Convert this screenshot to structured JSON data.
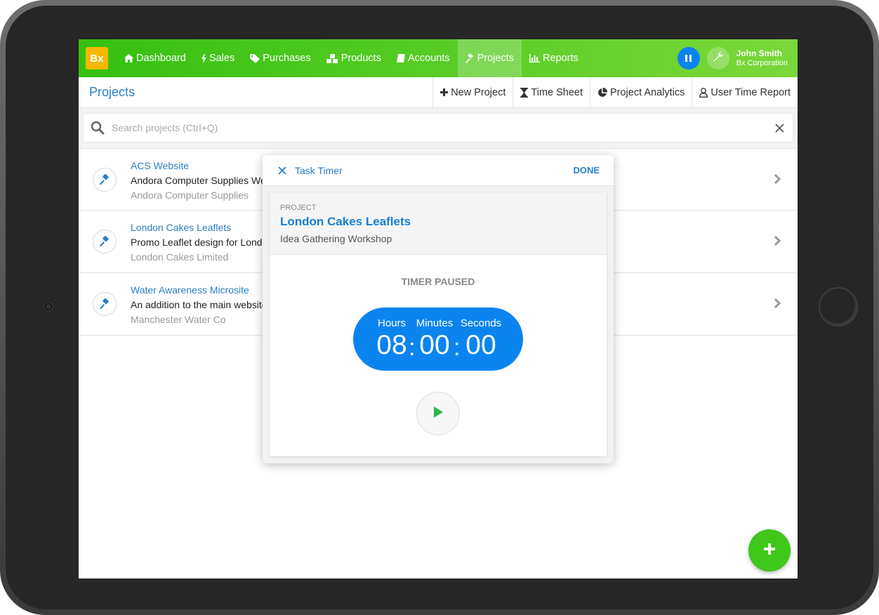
{
  "nav": {
    "logo": "Bx",
    "items": [
      {
        "label": "Dashboard",
        "icon": "home-icon"
      },
      {
        "label": "Sales",
        "icon": "bolt-icon"
      },
      {
        "label": "Purchases",
        "icon": "tag-icon"
      },
      {
        "label": "Products",
        "icon": "cubes-icon"
      },
      {
        "label": "Accounts",
        "icon": "book-icon"
      },
      {
        "label": "Projects",
        "icon": "gavel-icon",
        "active": true
      },
      {
        "label": "Reports",
        "icon": "bar-chart-icon"
      }
    ],
    "user": {
      "name": "John Smith",
      "company": "Bx Corporation"
    },
    "accent": "#34c010",
    "accent_end": "#7bd83a"
  },
  "subheader": {
    "title": "Projects",
    "actions": [
      {
        "label": "New Project",
        "icon": "plus-icon"
      },
      {
        "label": "Time Sheet",
        "icon": "hourglass-icon"
      },
      {
        "label": "Project Analytics",
        "icon": "pie-chart-icon"
      },
      {
        "label": "User Time Report",
        "icon": "user-icon"
      }
    ]
  },
  "search": {
    "placeholder": "Search projects (Ctrl+Q)",
    "value": ""
  },
  "projects": [
    {
      "name": "ACS Website",
      "description": "Andora Computer Supplies We",
      "client": "Andora Computer Supplies"
    },
    {
      "name": "London Cakes Leaflets",
      "description": "Promo Leaflet design for Lond",
      "client": "London Cakes Limited"
    },
    {
      "name": "Water Awareness Microsite",
      "description": "An addition to the main website",
      "client": "Manchester Water Co"
    }
  ],
  "timer_modal": {
    "title": "Task Timer",
    "done_label": "DONE",
    "project_label": "PROJECT",
    "project_name": "London Cakes Leaflets",
    "task_name": "Idea Gathering Workshop",
    "status": "TIMER PAUSED",
    "units": {
      "hours": "Hours",
      "minutes": "Minutes",
      "seconds": "Seconds"
    },
    "time": {
      "hours": "08",
      "minutes": "00",
      "seconds": "00"
    },
    "separator": ":",
    "timer_color": "#0b84f0",
    "play_color": "#2fb84a"
  },
  "fab": {
    "icon": "plus-icon",
    "color": "#3fc81a"
  }
}
